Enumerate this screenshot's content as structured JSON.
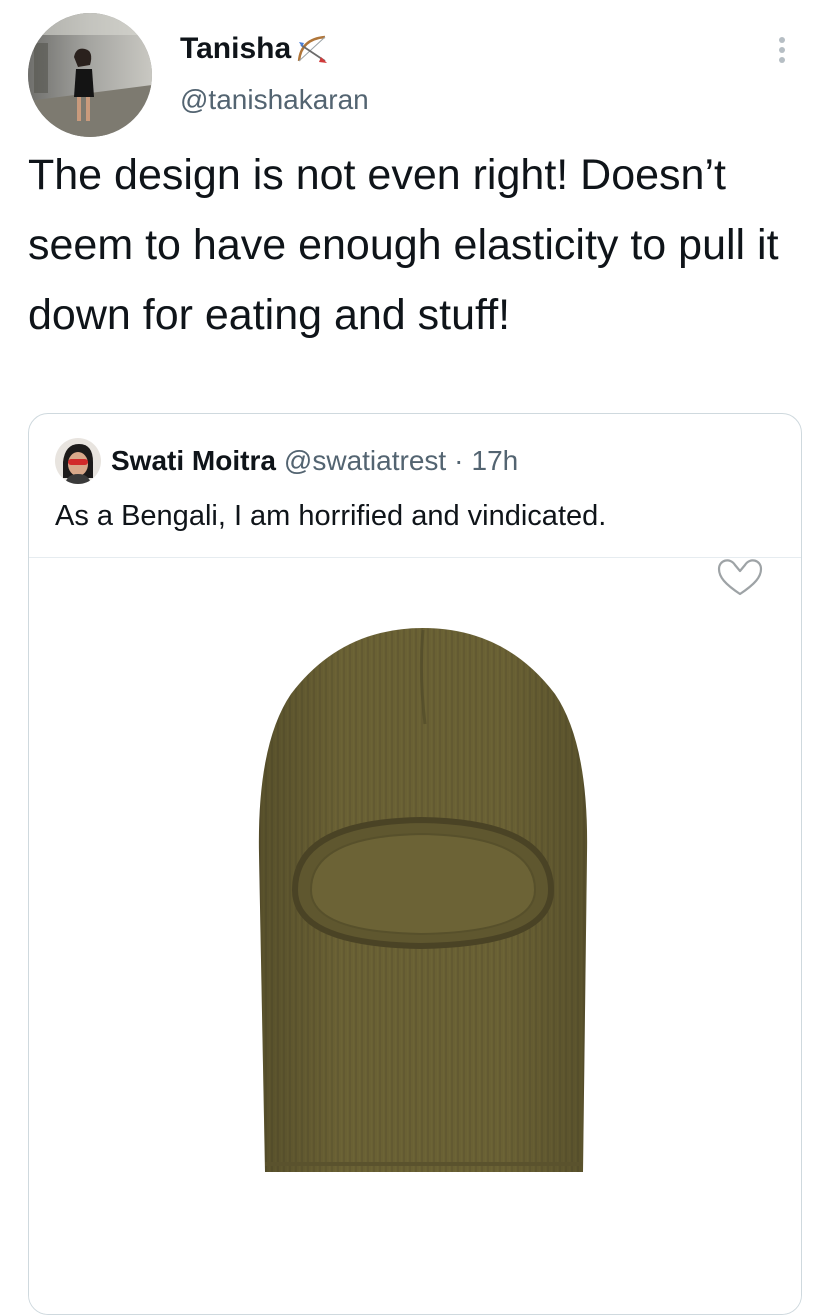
{
  "tweet": {
    "author_name": "Tanisha",
    "author_handle": "@tanishakaran",
    "text": "The design is not even right! Doesn’t seem to have enough elasticity to pull it down for eating and stuff!",
    "quoted_tweet": {
      "author_name": "Swati Moitra",
      "author_handle": "@swatiatrest",
      "separator": "·",
      "time": "17h",
      "text": "As a Bengali, I am horrified and vindicated."
    }
  },
  "icons": {
    "bow": "bow-and-arrow-emoji",
    "more": "more-vertical-icon",
    "heart": "heart-icon"
  },
  "colors": {
    "text_primary": "#0f1419",
    "text_secondary": "#536471",
    "border": "#cfd9de",
    "knit_olive": "#6a6134"
  }
}
